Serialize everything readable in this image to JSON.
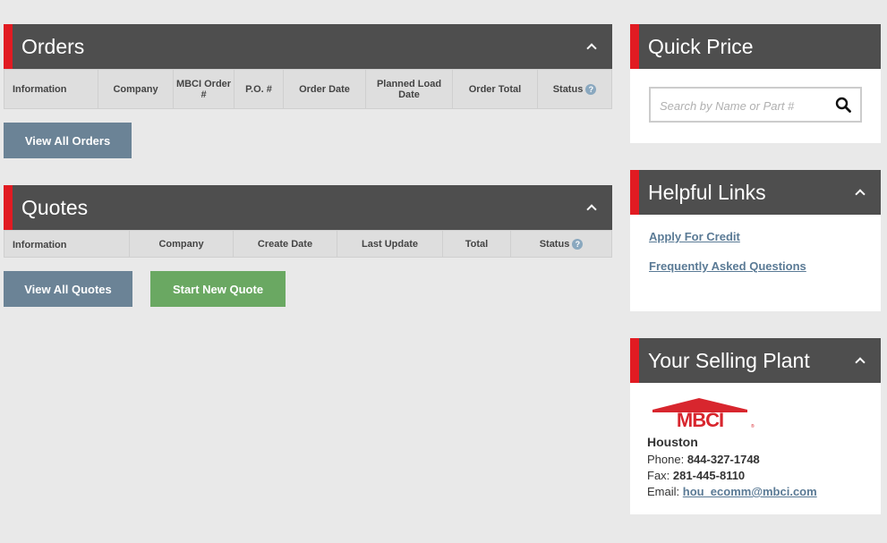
{
  "orders": {
    "title": "Orders",
    "columns": [
      "Information",
      "Company",
      "MBCI Order #",
      "P.O. #",
      "Order Date",
      "Planned Load Date",
      "Order Total",
      "Status"
    ],
    "view_all_label": "View All Orders"
  },
  "quotes": {
    "title": "Quotes",
    "columns": [
      "Information",
      "Company",
      "Create Date",
      "Last Update",
      "Total",
      "Status"
    ],
    "view_all_label": "View All Quotes",
    "new_quote_label": "Start New Quote"
  },
  "quick_price": {
    "title": "Quick Price",
    "search_placeholder": "Search by Name or Part #"
  },
  "helpful_links": {
    "title": "Helpful Links",
    "items": [
      "Apply For Credit",
      "Frequently Asked Questions"
    ]
  },
  "selling_plant": {
    "title": "Your Selling Plant",
    "logo_text": "MBCI",
    "city": "Houston",
    "phone_label": "Phone:",
    "phone": "844-327-1748",
    "fax_label": "Fax:",
    "fax": "281-445-8110",
    "email_label": "Email:",
    "email": "hou_ecomm@mbci.com"
  },
  "colors": {
    "header": "#4e4e4e",
    "accent": "#e11b22",
    "button_gray": "#6b8396",
    "button_green": "#6aa862",
    "link": "#5a7a95"
  },
  "icons": {
    "collapse": "chevron-up-icon",
    "help": "question-icon",
    "search": "search-icon"
  }
}
